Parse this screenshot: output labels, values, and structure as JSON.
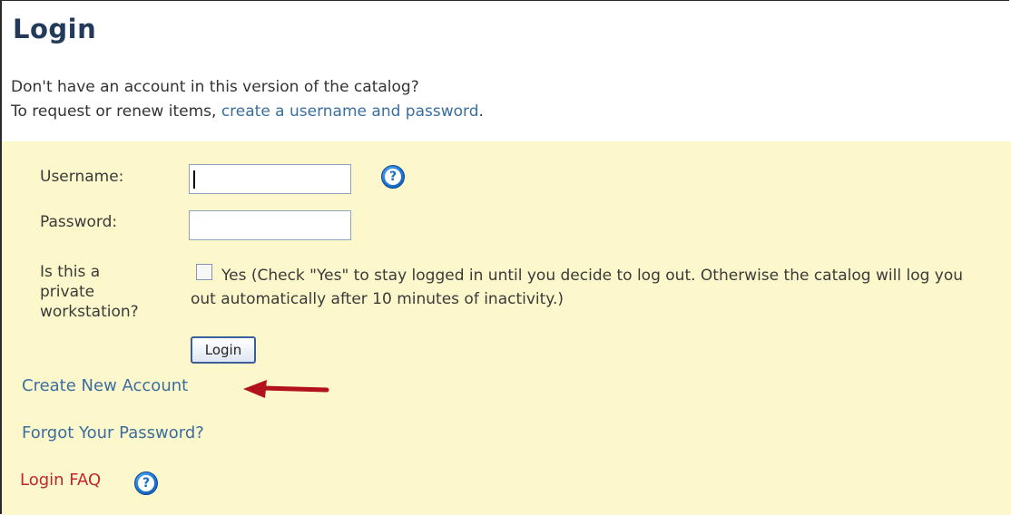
{
  "page": {
    "title": "Login",
    "intro_line1": "Don't have an account in this version of the catalog?",
    "intro_line2_prefix": "To request or renew items, ",
    "intro_line2_link": "create a username and password",
    "intro_line2_suffix": "."
  },
  "form": {
    "username_label": "Username:",
    "username_value": "",
    "password_label": "Password:",
    "password_value": "",
    "private_label_line1": "Is this a",
    "private_label_line2": "private",
    "private_label_line3": "workstation?",
    "private_checkbox_checked": false,
    "private_checkbox_text": "Yes  (Check \"Yes\" to stay logged in until you decide to log out. Otherwise the catalog will log you out automatically after 10 minutes of inactivity.)",
    "login_button_label": "Login"
  },
  "links": {
    "create_account": "Create New Account",
    "forgot_password": "Forgot Your Password?",
    "login_faq": "Login FAQ"
  },
  "icons": {
    "help": "?",
    "arrow": "red-arrow-left"
  },
  "colors": {
    "panel_bg": "#fdf8cc",
    "link": "#3a6e9e",
    "faq_link": "#c0262e",
    "title": "#233a58",
    "arrow": "#b3121c"
  }
}
